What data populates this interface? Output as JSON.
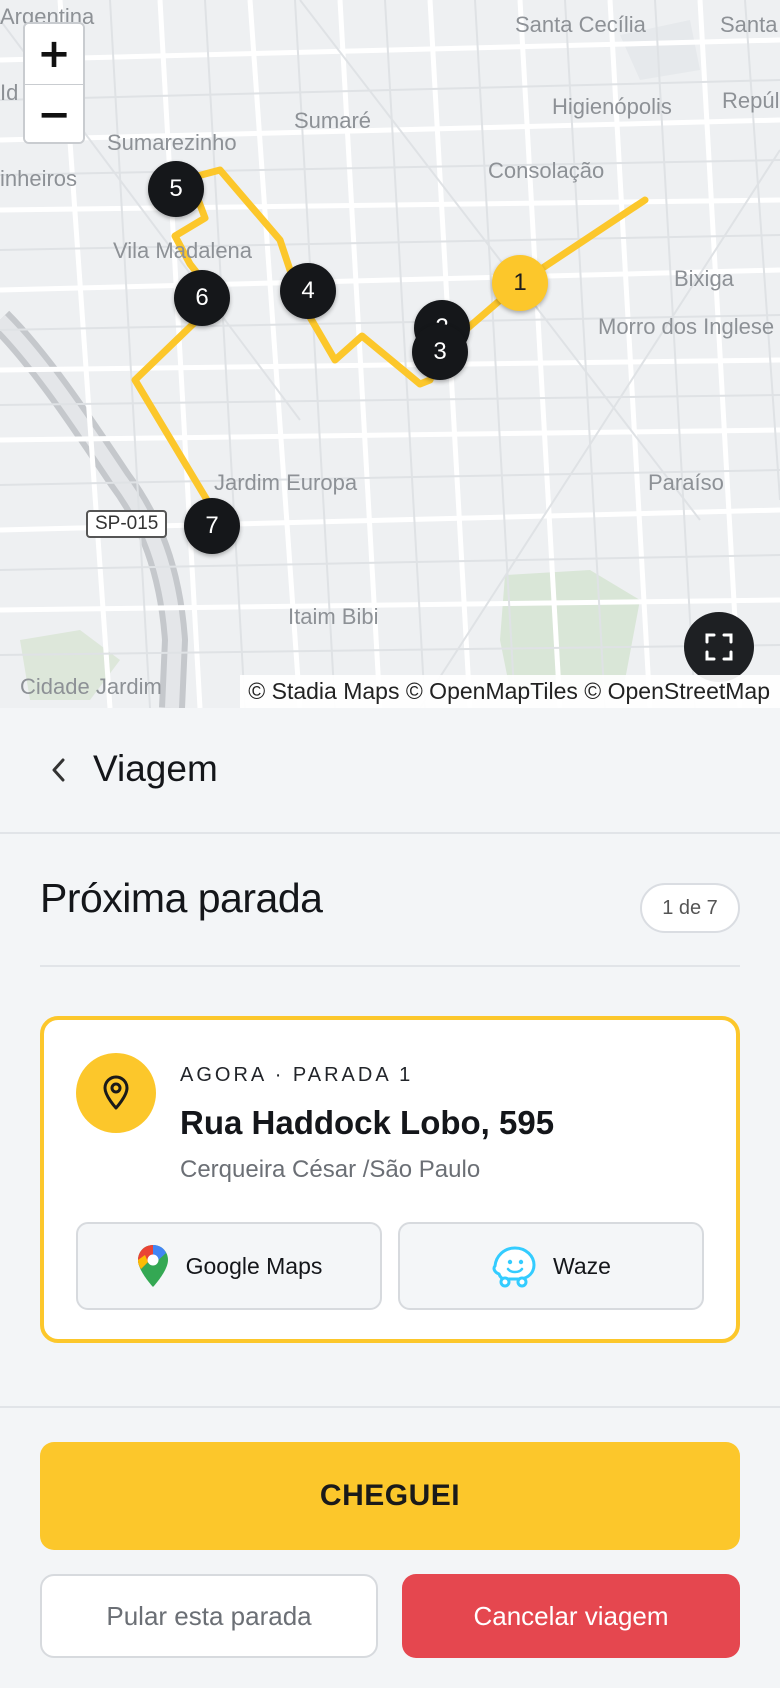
{
  "map": {
    "zoom_in_label": "+",
    "zoom_out_label": "−",
    "labels": {
      "argentina": "Argentina",
      "santa_cecilia": "Santa Cecília",
      "santa": "Santa",
      "higienopolis": "Higienópolis",
      "repu": "Repúl",
      "sumare": "Sumaré",
      "sumarezinho": "Sumarezinho",
      "consolacao": "Consolação",
      "pinheiros": "inheiros",
      "vila_madalena": "Vila Madalena",
      "bixiga": "Bixiga",
      "morro": "Morro dos Inglese",
      "jardim_europa": "Jardim Europa",
      "paraiso": "Paraíso",
      "itaim": "Itaim Bibi",
      "cidade_jardim": "Cidade Jardim",
      "ld": "Id"
    },
    "road_shield": "SP-015",
    "markers": [
      "1",
      "2",
      "3",
      "4",
      "5",
      "6",
      "7"
    ],
    "attribution": "© Stadia Maps © OpenMapTiles © OpenStreetMap",
    "route_color": "#fcc72b"
  },
  "header": {
    "title": "Viagem"
  },
  "section": {
    "title": "Próxima parada",
    "count": "1 de 7"
  },
  "card": {
    "eyebrow": "AGORA · PARADA 1",
    "address": "Rua Haddock Lobo, 595",
    "subtitle": "Cerqueira César /São Paulo",
    "google_maps_label": "Google Maps",
    "waze_label": "Waze"
  },
  "footer": {
    "primary_label": "CHEGUEI",
    "skip_label": "Pular esta parada",
    "cancel_label": "Cancelar viagem"
  },
  "colors": {
    "accent": "#fcc72b",
    "danger": "#e5474f",
    "dark": "#15171a"
  }
}
